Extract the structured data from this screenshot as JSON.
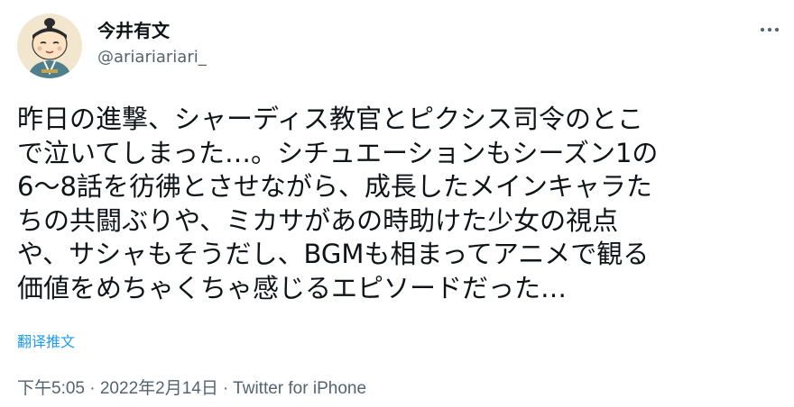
{
  "tweet": {
    "author": {
      "display_name": "今井有文",
      "handle": "@ariariariari_",
      "avatar_icon": "cartoon-avatar-icon"
    },
    "more_icon": "more-options-icon",
    "text_lines": [
      "昨日の進撃、シャーディス教官とピクシス司令のとこ",
      "で泣いてしまった…。シチュエーションもシーズン1の",
      "6〜8話を彷彿とさせながら、成長したメインキャラた",
      "ちの共闘ぶりや、ミカサがあの時助けた少女の視点",
      "や、サシャもそうだし、BGMも相まってアニメで観る",
      "価値をめちゃくちゃ感じるエピソードだった…"
    ],
    "translate_label": "翻译推文",
    "timestamp": "下午5:05 · 2022年2月14日",
    "separator": "·",
    "source": "Twitter for iPhone"
  },
  "colors": {
    "text_primary": "#0f1419",
    "text_secondary": "#536471",
    "link": "#1d9bf0",
    "background": "#ffffff"
  }
}
